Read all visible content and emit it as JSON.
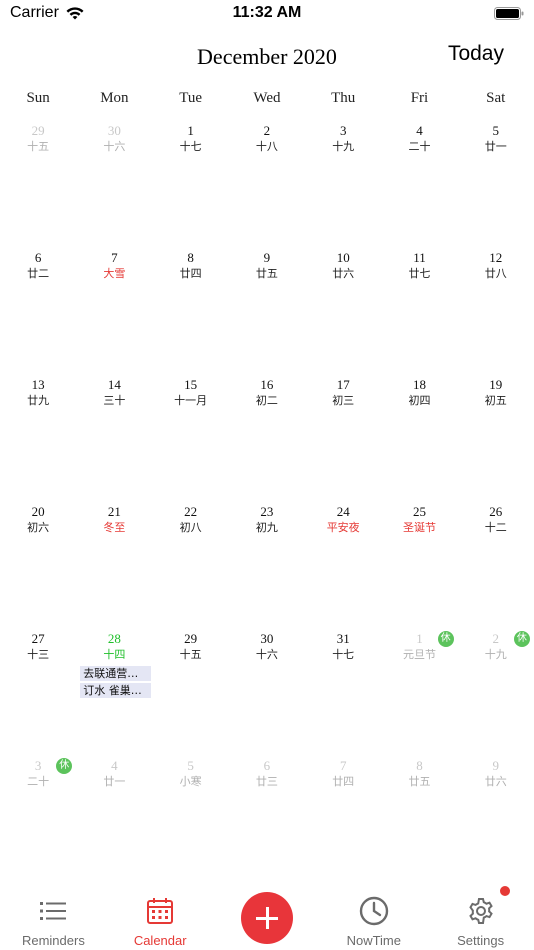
{
  "status_bar": {
    "carrier": "Carrier",
    "time": "11:32 AM"
  },
  "header": {
    "month_title": "December 2020",
    "today_label": "Today"
  },
  "weekdays": [
    "Sun",
    "Mon",
    "Tue",
    "Wed",
    "Thu",
    "Fri",
    "Sat"
  ],
  "weeks": [
    [
      {
        "num": "29",
        "lunar": "十五",
        "muted": true
      },
      {
        "num": "30",
        "lunar": "十六",
        "muted": true
      },
      {
        "num": "1",
        "lunar": "十七"
      },
      {
        "num": "2",
        "lunar": "十八"
      },
      {
        "num": "3",
        "lunar": "十九"
      },
      {
        "num": "4",
        "lunar": "二十"
      },
      {
        "num": "5",
        "lunar": "廿一"
      }
    ],
    [
      {
        "num": "6",
        "lunar": "廿二"
      },
      {
        "num": "7",
        "lunar": "大雪",
        "festival": true
      },
      {
        "num": "8",
        "lunar": "廿四"
      },
      {
        "num": "9",
        "lunar": "廿五"
      },
      {
        "num": "10",
        "lunar": "廿六"
      },
      {
        "num": "11",
        "lunar": "廿七"
      },
      {
        "num": "12",
        "lunar": "廿八"
      }
    ],
    [
      {
        "num": "13",
        "lunar": "廿九"
      },
      {
        "num": "14",
        "lunar": "三十"
      },
      {
        "num": "15",
        "lunar": "十一月"
      },
      {
        "num": "16",
        "lunar": "初二"
      },
      {
        "num": "17",
        "lunar": "初三"
      },
      {
        "num": "18",
        "lunar": "初四"
      },
      {
        "num": "19",
        "lunar": "初五"
      }
    ],
    [
      {
        "num": "20",
        "lunar": "初六"
      },
      {
        "num": "21",
        "lunar": "冬至",
        "festival": true
      },
      {
        "num": "22",
        "lunar": "初八"
      },
      {
        "num": "23",
        "lunar": "初九"
      },
      {
        "num": "24",
        "lunar": "平安夜",
        "festival": true
      },
      {
        "num": "25",
        "lunar": "圣诞节",
        "festival": true
      },
      {
        "num": "26",
        "lunar": "十二"
      }
    ],
    [
      {
        "num": "27",
        "lunar": "十三"
      },
      {
        "num": "28",
        "lunar": "十四",
        "today": true,
        "events": [
          "去联通营…",
          "订水 雀巢…"
        ]
      },
      {
        "num": "29",
        "lunar": "十五"
      },
      {
        "num": "30",
        "lunar": "十六"
      },
      {
        "num": "31",
        "lunar": "十七"
      },
      {
        "num": "1",
        "lunar": "元旦节",
        "muted": true,
        "badge": "休"
      },
      {
        "num": "2",
        "lunar": "十九",
        "muted": true,
        "badge": "休"
      }
    ],
    [
      {
        "num": "3",
        "lunar": "二十",
        "muted": true,
        "badge": "休"
      },
      {
        "num": "4",
        "lunar": "廿一",
        "muted": true
      },
      {
        "num": "5",
        "lunar": "小寒",
        "muted": true
      },
      {
        "num": "6",
        "lunar": "廿三",
        "muted": true
      },
      {
        "num": "7",
        "lunar": "廿四",
        "muted": true
      },
      {
        "num": "8",
        "lunar": "廿五",
        "muted": true
      },
      {
        "num": "9",
        "lunar": "廿六",
        "muted": true
      }
    ]
  ],
  "tabs": {
    "reminders": "Reminders",
    "calendar": "Calendar",
    "nowtime": "NowTime",
    "settings": "Settings"
  },
  "colors": {
    "accent": "#e53935",
    "today": "#1fbf2a",
    "holiday_badge": "#5cc35c",
    "event_bg": "#e4e6f4"
  }
}
